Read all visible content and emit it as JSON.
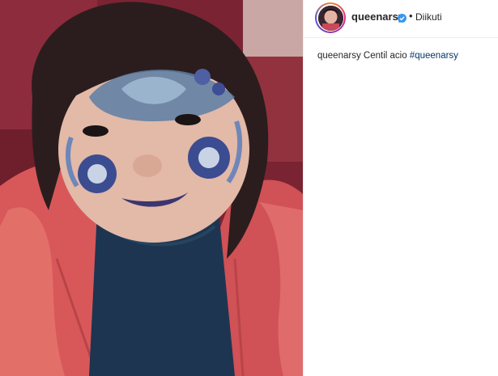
{
  "post": {
    "username": "queenarsy",
    "separator": "•",
    "follow_status": "Diikuti",
    "caption": {
      "username": "queenarsy",
      "text": "Centil acio",
      "hashtag": "#queenarsy"
    },
    "verified_icon": "verified-badge-icon",
    "photo_description_icon": "photo"
  }
}
